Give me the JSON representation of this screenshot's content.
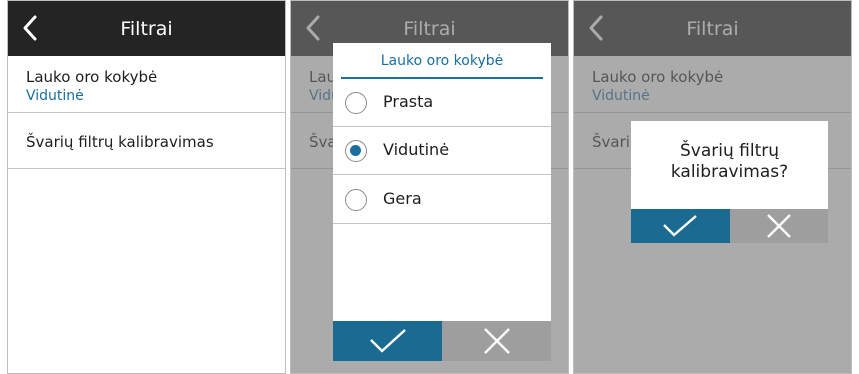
{
  "header": {
    "title": "Filtrai",
    "back_icon": "chevron-left-icon"
  },
  "settings": {
    "outdoor_quality_label": "Lauko oro kokybė",
    "outdoor_quality_value": "Vidutinė",
    "calibration_label": "Švarių filtrų kalibravimas"
  },
  "select_dialog": {
    "title": "Lauko oro kokybė",
    "options": [
      {
        "label": "Prasta",
        "selected": false
      },
      {
        "label": "Vidutinė",
        "selected": true
      },
      {
        "label": "Gera",
        "selected": false
      }
    ]
  },
  "confirm_dialog": {
    "question_line1": "Švarių filtrų",
    "question_line2": "kalibravimas?"
  },
  "colors": {
    "accent": "#1a6e9e",
    "confirm_button": "#1b6a92",
    "cancel_button": "#9e9e9e",
    "titlebar": "#242424"
  }
}
